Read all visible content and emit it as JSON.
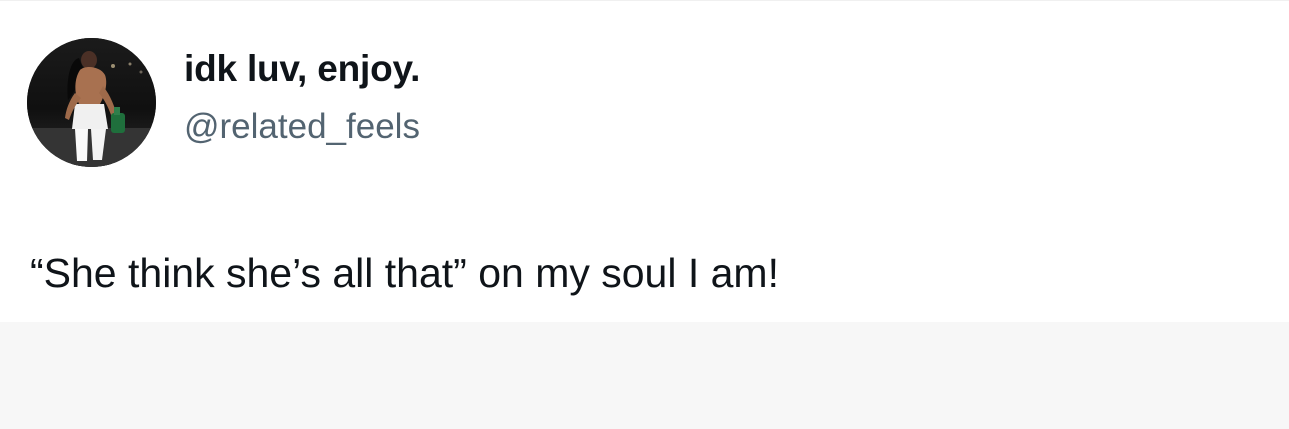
{
  "tweet": {
    "author": {
      "display_name": "idk luv, enjoy.",
      "handle": "@related_feels",
      "avatar_icon": "profile-photo"
    },
    "text": "“She think she’s all that” on my soul I am!"
  },
  "colors": {
    "card_background": "#ffffff",
    "page_background": "#f7f7f7",
    "primary_text": "#0f1419",
    "secondary_text": "#536471"
  }
}
